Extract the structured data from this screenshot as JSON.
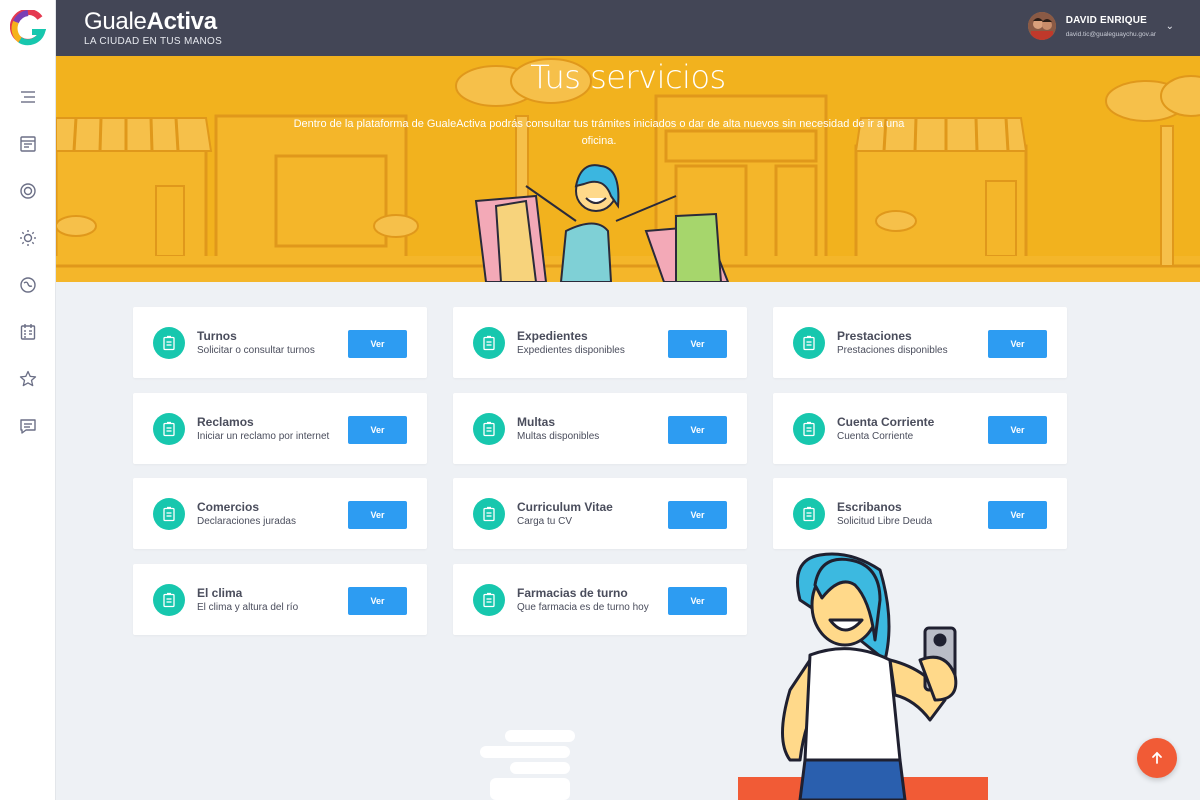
{
  "header": {
    "brand_part1": "Guale",
    "brand_part2": "Activa",
    "tagline": "LA CIUDAD EN TUS MANOS",
    "user_name": "DAVID ENRIQUE",
    "user_email": "david.tic@gualeguaychu.gov.ar"
  },
  "sidebar": {
    "items": [
      {
        "icon": "menu-lines-icon"
      },
      {
        "icon": "browser-window-icon"
      },
      {
        "icon": "target-circle-icon"
      },
      {
        "icon": "sun-icon"
      },
      {
        "icon": "globe-icon"
      },
      {
        "icon": "calendar-icon"
      },
      {
        "icon": "star-icon"
      },
      {
        "icon": "chat-icon"
      }
    ]
  },
  "hero": {
    "title": "Tus servicios",
    "description": "Dentro de la plataforma de GualeActiva podrás consultar tus trámites iniciados o dar de alta nuevos sin necesidad de ir a una oficina."
  },
  "services": [
    {
      "title": "Turnos",
      "subtitle": "Solicitar o consultar turnos",
      "button": "Ver"
    },
    {
      "title": "Expedientes",
      "subtitle": "Expedientes disponibles",
      "button": "Ver"
    },
    {
      "title": "Prestaciones",
      "subtitle": "Prestaciones disponibles",
      "button": "Ver"
    },
    {
      "title": "Reclamos",
      "subtitle": "Iniciar un reclamo por internet",
      "button": "Ver"
    },
    {
      "title": "Multas",
      "subtitle": "Multas disponibles",
      "button": "Ver"
    },
    {
      "title": "Cuenta Corriente",
      "subtitle": "Cuenta Corriente",
      "button": "Ver"
    },
    {
      "title": "Comercios",
      "subtitle": "Declaraciones juradas",
      "button": "Ver"
    },
    {
      "title": "Curriculum Vitae",
      "subtitle": "Carga tu CV",
      "button": "Ver"
    },
    {
      "title": "Escribanos",
      "subtitle": "Solicitud Libre Deuda",
      "button": "Ver"
    },
    {
      "title": "El clima",
      "subtitle": "El clima y altura del río",
      "button": "Ver"
    },
    {
      "title": "Farmacias de turno",
      "subtitle": "Que farmacia es de turno hoy",
      "button": "Ver"
    }
  ],
  "colors": {
    "header_bg": "#434656",
    "hero_bg": "#f2b21e",
    "accent_teal": "#17c7ae",
    "button_blue": "#2d9cf2",
    "fab_orange": "#f15b36"
  }
}
